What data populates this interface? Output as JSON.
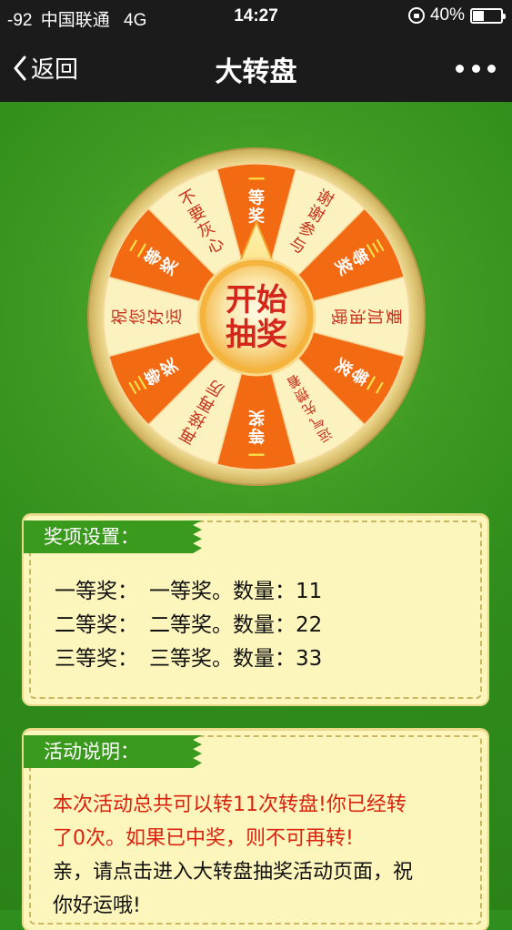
{
  "status_bar": {
    "signal": "-92",
    "carrier": "中国联通",
    "network": "4G",
    "time": "14:27",
    "battery": "40%",
    "battery_level": 0.4
  },
  "nav": {
    "back_label": "返回",
    "title": "大转盘",
    "more_icon": "more-dots-icon"
  },
  "wheel": {
    "center_line1": "开始",
    "center_line2": "抽奖",
    "segments": [
      {
        "label": "一等奖",
        "color": "#f26a12"
      },
      {
        "label": "谢谢参与",
        "color": "#fbf2c0"
      },
      {
        "label": "三等奖",
        "color": "#f26a12"
      },
      {
        "label": "要加油哦",
        "color": "#fbf2c0"
      },
      {
        "label": "二等奖",
        "color": "#f26a12"
      },
      {
        "label": "运气先攒着",
        "color": "#fbf2c0"
      },
      {
        "label": "一等奖",
        "color": "#f26a12"
      },
      {
        "label": "再接再厉",
        "color": "#fbf2c0"
      },
      {
        "label": "三等奖",
        "color": "#f26a12"
      },
      {
        "label": "祝您好运",
        "color": "#fbf2c0"
      },
      {
        "label": "二等奖",
        "color": "#f26a12"
      },
      {
        "label": "不要灰心",
        "color": "#fbf2c0"
      }
    ]
  },
  "prizes_card": {
    "title": "奖项设置：",
    "rows": [
      {
        "name": "一等奖：",
        "detail": "一等奖。数量：11"
      },
      {
        "name": "二等奖：",
        "detail": "二等奖。数量：22"
      },
      {
        "name": "三等奖：",
        "detail": "三等奖。数量：33"
      }
    ]
  },
  "rules_card": {
    "title": "活动说明：",
    "line1": "本次活动总共可以转11次转盘!你已经转",
    "line2": "了0次。如果已中奖，则不可再转!",
    "line3": "亲，请点击进入大转盘抽奖活动页面，祝",
    "line4": "你好运哦!"
  },
  "colors": {
    "orange_segment": "#f26a12",
    "cream_segment": "#fbf2c0",
    "background_green": "#3f9a24",
    "tab_green": "#3a9a1d",
    "card_bg": "#fdf6bc",
    "red_text": "#d9230f"
  }
}
